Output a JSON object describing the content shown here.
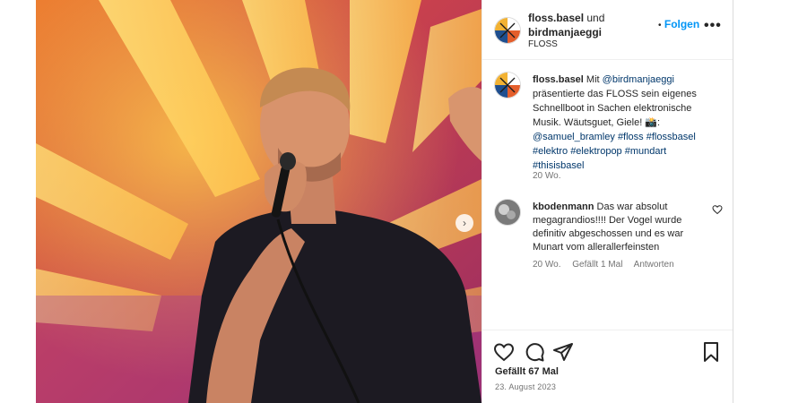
{
  "post": {
    "author": "floss.basel",
    "connector": "und",
    "coauthor": "birdmanjaeggi",
    "location": "FLOSS",
    "follow_bullet": "•",
    "follow_label": "Folgen",
    "more_label": "•••"
  },
  "caption": {
    "username": "floss.basel",
    "text_start": "Mit",
    "mention": "@birdmanjaeggi",
    "text_body": "präsentierte das FLOSS sein eigenes Schnellboot in Sachen elektronische Musik. Wäutsguet, Giele!",
    "emoji": "📸",
    "colon": ":",
    "photo_credit": "@samuel_bramley",
    "hashtags_line1": "#floss #flossbasel",
    "hashtags_line2": "#elektro #elektropop #mundart",
    "hashtags_line3": "#thisisbasel",
    "time": "20 Wo."
  },
  "comment": {
    "username": "kbodenmann",
    "text": "Das war absolut megagrandios!!!! Der Vogel wurde definitiv abgeschossen und es war Munart vom allerallerfeinsten",
    "time": "20 Wo.",
    "likes": "Gefällt 1 Mal",
    "reply": "Antworten"
  },
  "footer": {
    "likes": "Gefällt 67 Mal",
    "date": "23. August 2023"
  },
  "media": {
    "next_icon": "chevron-right-icon",
    "next_glyph": "›"
  }
}
